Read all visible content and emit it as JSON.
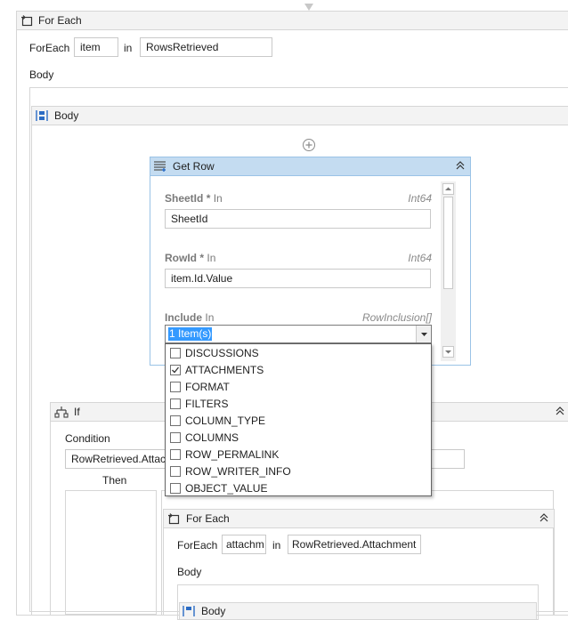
{
  "outer_foreach": {
    "title": "For Each",
    "foreach_label": "ForEach",
    "item_value": "item",
    "in_label": "in",
    "collection_value": "RowsRetrieved",
    "body_label": "Body"
  },
  "body_sequence": {
    "title": "Body"
  },
  "get_row": {
    "title": "Get Row",
    "sheet_id": {
      "label": "SheetId",
      "required": "*",
      "direction": "In",
      "type": "Int64",
      "value": "SheetId"
    },
    "row_id": {
      "label": "RowId",
      "required": "*",
      "direction": "In",
      "type": "Int64",
      "value": "item.Id.Value"
    },
    "include": {
      "label": "Include",
      "direction": "In",
      "type": "RowInclusion[]",
      "selected": "1 Item(s)"
    }
  },
  "include_dropdown": {
    "options": [
      {
        "label": "DISCUSSIONS",
        "checked": false
      },
      {
        "label": "ATTACHMENTS",
        "checked": true
      },
      {
        "label": "FORMAT",
        "checked": false
      },
      {
        "label": "FILTERS",
        "checked": false
      },
      {
        "label": "COLUMN_TYPE",
        "checked": false
      },
      {
        "label": "COLUMNS",
        "checked": false
      },
      {
        "label": "ROW_PERMALINK",
        "checked": false
      },
      {
        "label": "ROW_WRITER_INFO",
        "checked": false
      },
      {
        "label": "OBJECT_VALUE",
        "checked": false
      }
    ]
  },
  "if_activity": {
    "title": "If",
    "condition_label": "Condition",
    "condition_value": "RowRetrieved.Attach",
    "then_label": "Then"
  },
  "inner_foreach": {
    "title": "For Each",
    "foreach_label": "ForEach",
    "item_value": "attachm",
    "in_label": "in",
    "collection_value": "RowRetrieved.Attachment",
    "body_label": "Body",
    "nested_title": "Body"
  },
  "icons": {
    "foreach": "foreach-loop-icon",
    "sequence": "sequence-icon",
    "getrow": "table-row-icon",
    "if": "if-branch-icon",
    "add": "add-circle-icon",
    "collapse": "chevron-up-double-icon",
    "dropdown": "triangle-down-icon",
    "checkmark": "checkmark-icon"
  }
}
